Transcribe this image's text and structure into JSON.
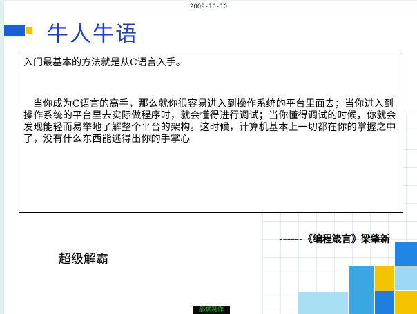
{
  "header": {
    "date": "2009-10-10",
    "title": "牛人牛语"
  },
  "content": {
    "line1": "入门最基本的方法就是从C语言入手。",
    "paragraph": "当你成为C语言的高手，那么就你很容易进入到操作系统的平台里面去；当你进入到操作系统的平台里去实际做程序时，就会懂得进行调试；当你懂得调试的时候，你就会发现能轻而易举地了解整个平台的架构。这时候，计算机基本上一切都在你的掌握之中了，没有什么东西能逃得出你的手掌心"
  },
  "quote": "------《编程箴言》梁肇新",
  "subtitle": "超级解霸",
  "footer": {
    "credit": "郝斌制作"
  },
  "colors": {
    "title_blue": "#1a3fd0",
    "marker_blue": "#1a5fd6",
    "marker_yellow": "#f2c400",
    "credit_green": "#1ec31e"
  }
}
